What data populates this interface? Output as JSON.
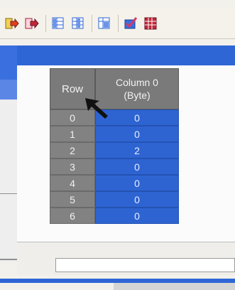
{
  "toolbar": {
    "buttons": [
      {
        "icon": "import-arrow-icon",
        "color": "#e0a800"
      },
      {
        "icon": "export-arrow-icon",
        "color": "#c0283a"
      },
      {
        "icon": "insert-column-icon",
        "color": "#2f66d6"
      },
      {
        "icon": "delete-column-icon",
        "color": "#2f66d6"
      },
      {
        "icon": "column-properties-icon",
        "color": "#2f66d6"
      },
      {
        "icon": "edit-check-icon",
        "color": "#d13a6a"
      },
      {
        "icon": "grid-color-icon",
        "color": "#c0283a"
      }
    ]
  },
  "grid": {
    "row_header": "Row",
    "column_header_line1": "Column 0",
    "column_header_line2": "(Byte)",
    "rows": [
      {
        "index": "0",
        "value": "0"
      },
      {
        "index": "1",
        "value": "0"
      },
      {
        "index": "2",
        "value": "2"
      },
      {
        "index": "3",
        "value": "0"
      },
      {
        "index": "4",
        "value": "0"
      },
      {
        "index": "5",
        "value": "0"
      },
      {
        "index": "6",
        "value": "0"
      }
    ]
  },
  "colors": {
    "accent": "#2f66d6",
    "header_gray": "#7a7a7a"
  }
}
